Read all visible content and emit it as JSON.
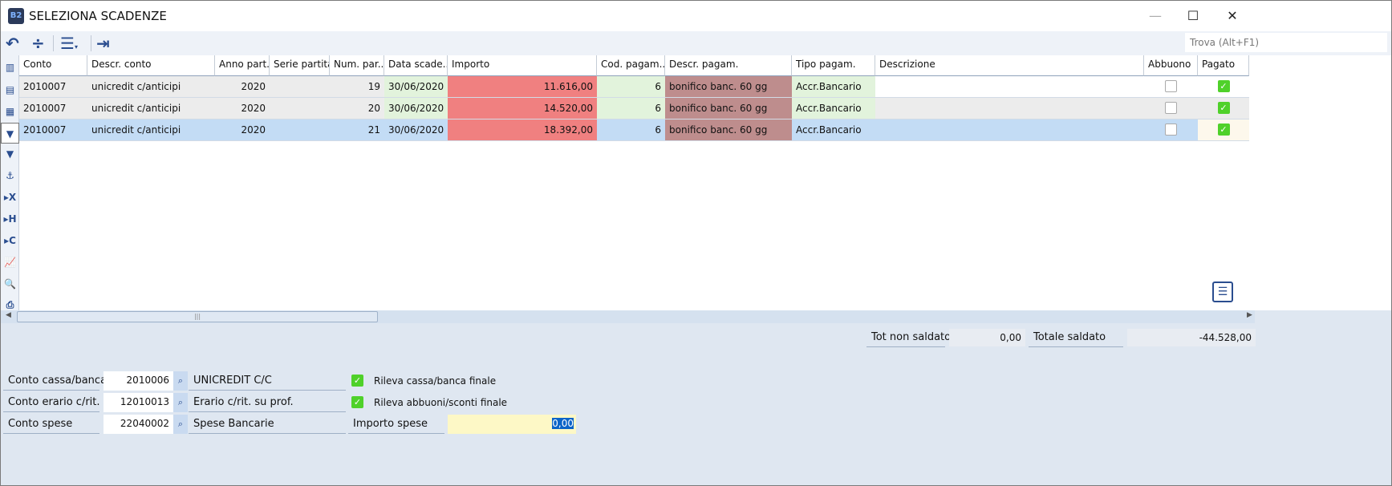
{
  "window": {
    "title": "SELEZIONA SCADENZE",
    "logo": "B2"
  },
  "toolbar": {
    "find_placeholder": "Trova (Alt+F1)"
  },
  "grid": {
    "columns": [
      "Conto",
      "Descr. conto",
      "Anno part...",
      "Serie partita",
      "Num. par...",
      "Data scade...",
      "Importo",
      "Cod. pagam...",
      "Descr. pagam.",
      "Tipo pagam.",
      "Descrizione",
      "Abbuono",
      "Pagato"
    ],
    "rows": [
      {
        "conto": "2010007",
        "descr": "unicredit c/anticipi",
        "anno": "2020",
        "serie": "",
        "num": "19",
        "data": "30/06/2020",
        "importo": "11.616,00",
        "cod": "6",
        "descr_pag": "bonifico banc. 60 gg",
        "tipo": "Accr.Bancario",
        "descrizione": "",
        "abbuono": false,
        "pagato": true
      },
      {
        "conto": "2010007",
        "descr": "unicredit c/anticipi",
        "anno": "2020",
        "serie": "",
        "num": "20",
        "data": "30/06/2020",
        "importo": "14.520,00",
        "cod": "6",
        "descr_pag": "bonifico banc. 60 gg",
        "tipo": "Accr.Bancario",
        "descrizione": "",
        "abbuono": false,
        "pagato": true
      },
      {
        "conto": "2010007",
        "descr": "unicredit c/anticipi",
        "anno": "2020",
        "serie": "",
        "num": "21",
        "data": "30/06/2020",
        "importo": "18.392,00",
        "cod": "6",
        "descr_pag": "bonifico banc. 60 gg",
        "tipo": "Accr.Bancario",
        "descrizione": "",
        "abbuono": false,
        "pagato": true
      }
    ],
    "selected_row": 2
  },
  "totals": {
    "non_saldato_label": "Tot non saldato",
    "non_saldato": "0,00",
    "saldato_label": "Totale saldato",
    "saldato": "-44.528,00"
  },
  "form": {
    "cassa_label": "Conto cassa/banca",
    "cassa_code": "2010006",
    "cassa_desc": "UNICREDIT C/C",
    "erario_label": "Conto erario c/rit.",
    "erario_code": "12010013",
    "erario_desc": "Erario c/rit. su prof.",
    "spese_label": "Conto spese",
    "spese_code": "22040002",
    "spese_desc": "Spese Bancarie",
    "rileva_cassa": "Rileva cassa/banca finale",
    "rileva_abbuoni": "Rileva abbuoni/sconti finale",
    "importo_spese_label": "Importo spese",
    "importo_spese": "0,00"
  },
  "colors": {
    "importo": "#f08080",
    "green": "#e2f3dc",
    "descr_pag": "#be8d8d",
    "selected": "#c3dcf5"
  }
}
